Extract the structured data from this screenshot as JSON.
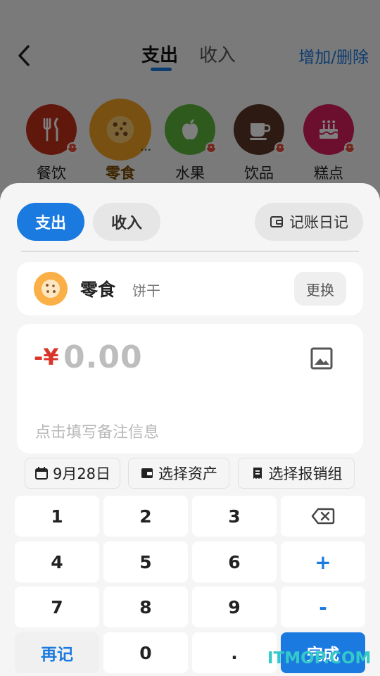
{
  "header": {
    "back_icon": "chevron-left-icon",
    "tabs": [
      {
        "label": "支出",
        "active": true
      },
      {
        "label": "收入",
        "active": false
      }
    ],
    "manage_label": "增加/删除"
  },
  "categories": [
    {
      "label": "餐饮",
      "icon": "fork-knife-icon",
      "color": "#c0301b"
    },
    {
      "label": "零食",
      "icon": "cookie-icon",
      "color": "#f0a024",
      "selected": true
    },
    {
      "label": "水果",
      "icon": "apple-icon",
      "color": "#5cb43a"
    },
    {
      "label": "饮品",
      "icon": "coffee-cup-icon",
      "color": "#5a3526"
    },
    {
      "label": "糕点",
      "icon": "cake-icon",
      "color": "#d81d5c"
    }
  ],
  "sheet": {
    "type_tabs": {
      "expense": "支出",
      "income": "收入"
    },
    "diary_label": "记账日记",
    "selected_category": {
      "name": "零食",
      "sub": "饼干",
      "change_label": "更换"
    },
    "amount": {
      "prefix": "-¥",
      "value": "0.00"
    },
    "note_placeholder": "点击填写备注信息",
    "chips": {
      "date": "9月28日",
      "asset": "选择资产",
      "group": "选择报销组"
    }
  },
  "keypad": {
    "row1": [
      "1",
      "2",
      "3"
    ],
    "row2": [
      "4",
      "5",
      "6"
    ],
    "row3": [
      "7",
      "8",
      "9"
    ],
    "plus": "+",
    "minus": "-",
    "again": "再记",
    "zero": "0",
    "dot": ".",
    "done": "完成",
    "backspace_icon": "backspace-icon"
  },
  "watermark": "ITMOP.COM",
  "colors": {
    "accent": "#1a7ae0",
    "expense_red": "#d9362b",
    "cookie": "#fbb047"
  }
}
